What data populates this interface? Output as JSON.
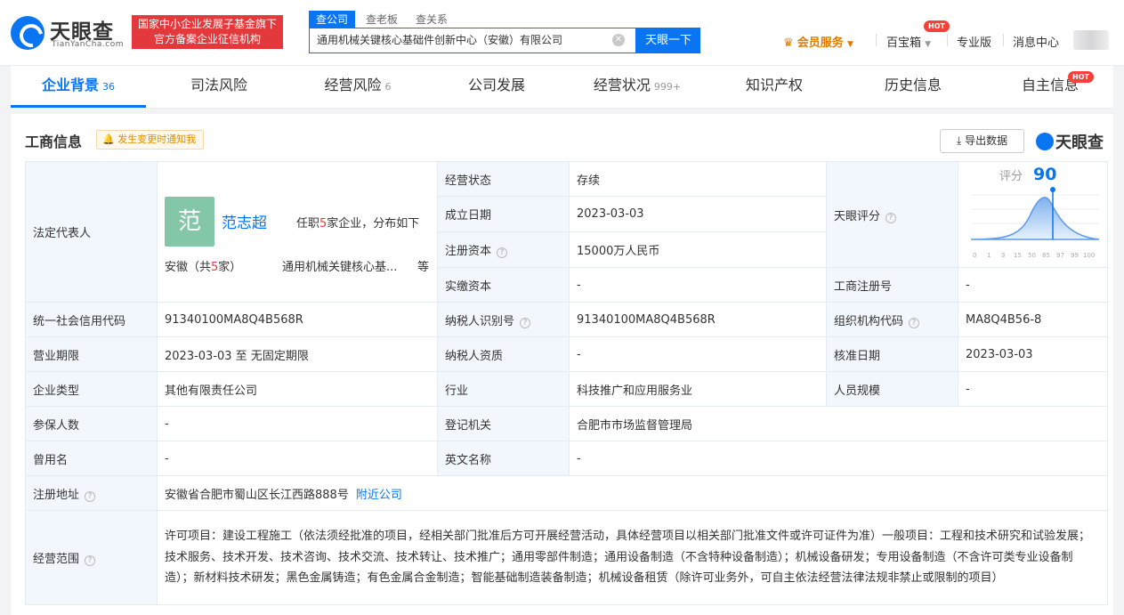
{
  "header": {
    "logo_text": "天眼查",
    "logo_sub": "TianYanCha.com",
    "badge_line1": "国家中小企业发展子基金旗下",
    "badge_line2": "官方备案企业征信机构",
    "search_tabs": [
      "查公司",
      "查老板",
      "查关系"
    ],
    "search_value": "通用机械关键核心基础件创新中心（安徽）有限公司",
    "search_button": "天眼一下",
    "vip": "会员服务",
    "baobao": "百宝箱",
    "hot": "HOT",
    "pro": "专业版",
    "messages": "消息中心"
  },
  "tabs": [
    {
      "label": "企业背景",
      "count": "36"
    },
    {
      "label": "司法风险",
      "count": ""
    },
    {
      "label": "经营风险",
      "count": "6"
    },
    {
      "label": "公司发展",
      "count": ""
    },
    {
      "label": "经营状况",
      "count": "999+"
    },
    {
      "label": "知识产权",
      "count": ""
    },
    {
      "label": "历史信息",
      "count": ""
    },
    {
      "label": "自主信息",
      "count": ""
    }
  ],
  "panel": {
    "title": "工商信息",
    "notify": "发生变更时通知我",
    "export": "导出数据",
    "logo": "天眼查"
  },
  "info": {
    "legal_rep_label": "法定代表人",
    "legal_avatar": "范",
    "legal_name": "范志超",
    "legal_tenure_pre": "任职",
    "legal_tenure_num": "5",
    "legal_tenure_post": "家企业，分布如下",
    "legal_region_pre": "安徽（共",
    "legal_region_num": "5",
    "legal_region_post": "家）",
    "legal_company": "通用机械关键核心基...",
    "legal_etc": "等",
    "status_label": "经营状态",
    "status_value": "存续",
    "found_label": "成立日期",
    "found_value": "2023-03-03",
    "capital_label": "注册资本",
    "capital_value": "15000万人民币",
    "paid_label": "实缴资本",
    "paid_value": "-",
    "score_label": "天眼评分",
    "score_title": "评分",
    "score_value": "90",
    "score_axis": [
      "0",
      "1",
      "3",
      "15",
      "50",
      "85",
      "97",
      "99",
      "100"
    ],
    "reg_no_label": "工商注册号",
    "reg_no_value": "-",
    "credit_label": "统一社会信用代码",
    "credit_value": "91340100MA8Q4B568R",
    "taxid_label": "纳税人识别号",
    "taxid_value": "91340100MA8Q4B568R",
    "org_label": "组织机构代码",
    "org_value": "MA8Q4B56-8",
    "term_label": "营业期限",
    "term_value": "2023-03-03 至 无固定期限",
    "taxq_label": "纳税人资质",
    "taxq_value": "-",
    "approve_label": "核准日期",
    "approve_value": "2023-03-03",
    "type_label": "企业类型",
    "type_value": "其他有限责任公司",
    "industry_label": "行业",
    "industry_value": "科技推广和应用服务业",
    "staff_label": "人员规模",
    "staff_value": "-",
    "insured_label": "参保人数",
    "insured_value": "-",
    "authority_label": "登记机关",
    "authority_value": "合肥市市场监督管理局",
    "former_label": "曾用名",
    "former_value": "-",
    "english_label": "英文名称",
    "english_value": "-",
    "address_label": "注册地址",
    "address_value": "安徽省合肥市蜀山区长江西路888号",
    "address_link": "附近公司",
    "scope_label": "经营范围",
    "scope_value": "许可项目：建设工程施工（依法须经批准的项目，经相关部门批准后方可开展经营活动，具体经营项目以相关部门批准文件或许可证件为准）一般项目：工程和技术研究和试验发展；技术服务、技术开发、技术咨询、技术交流、技术转让、技术推广；通用零部件制造；通用设备制造（不含特种设备制造）；机械设备研发；专用设备制造（不含许可类专业设备制造）；新材料技术研发；黑色金属铸造；有色金属合金制造；智能基础制造装备制造；机械设备租赁（除许可业务外，可自主依法经营法律法规非禁止或限制的项目）"
  }
}
